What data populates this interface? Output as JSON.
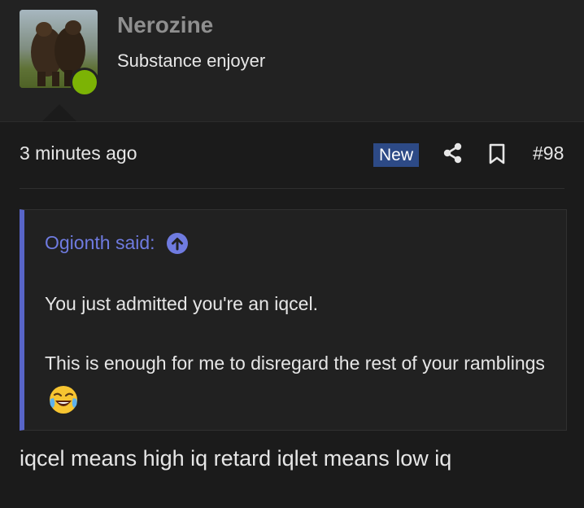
{
  "user": {
    "name": "Nerozine",
    "title": "Substance enjoyer",
    "status_color": "#7cb305"
  },
  "post": {
    "time": "3 minutes ago",
    "badge": "New",
    "number": "#98",
    "body": "iqcel means high iq retard iqlet means low iq"
  },
  "quote": {
    "author_said": "Ogionth said:",
    "line1": "You just admitted you're an iqcel.",
    "line2": "This is enough for me to disregard the rest of your ramblings",
    "emoji": "face-with-tears-of-joy"
  },
  "icons": {
    "share": "share-icon",
    "bookmark": "bookmark-icon",
    "jump": "arrow-up-circle-icon"
  },
  "colors": {
    "accent": "#6f7be0",
    "quote_border": "#5865c8",
    "badge_bg": "#2d4a86"
  }
}
